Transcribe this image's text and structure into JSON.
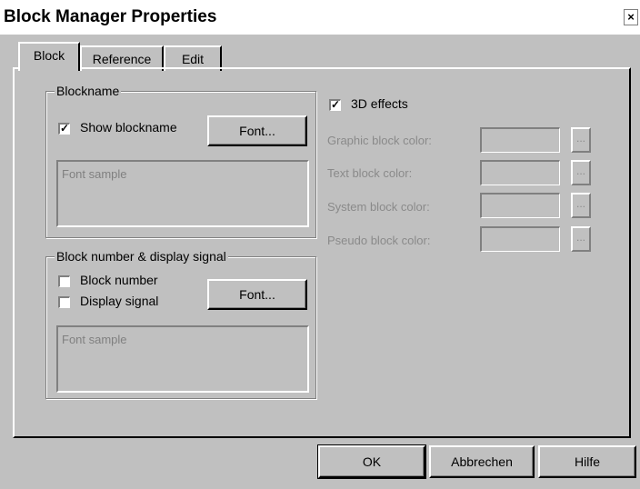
{
  "window": {
    "title": "Block Manager Properties",
    "close_glyph": "×"
  },
  "tabs": [
    {
      "label": "Block",
      "active": true
    },
    {
      "label": "Reference",
      "active": false
    },
    {
      "label": "Edit",
      "active": false
    }
  ],
  "blockname_group": {
    "legend": "Blockname",
    "show_blockname": {
      "label": "Show blockname",
      "checked": true
    },
    "font_button": "Font...",
    "font_sample": "Font sample"
  },
  "block_number_group": {
    "legend": "Block number & display signal",
    "block_number": {
      "label": "Block number",
      "checked": false
    },
    "display_signal": {
      "label": "Display signal",
      "checked": false
    },
    "font_button": "Font...",
    "font_sample": "Font sample"
  },
  "effects": {
    "three_d": {
      "label": "3D effects",
      "checked": true
    },
    "rows": [
      {
        "label": "Graphic block color:"
      },
      {
        "label": "Text block color:"
      },
      {
        "label": "System block color:"
      },
      {
        "label": "Pseudo block color:"
      }
    ],
    "ellipsis": "..."
  },
  "footer": {
    "ok": "OK",
    "cancel": "Abbrechen",
    "help": "Hilfe"
  }
}
